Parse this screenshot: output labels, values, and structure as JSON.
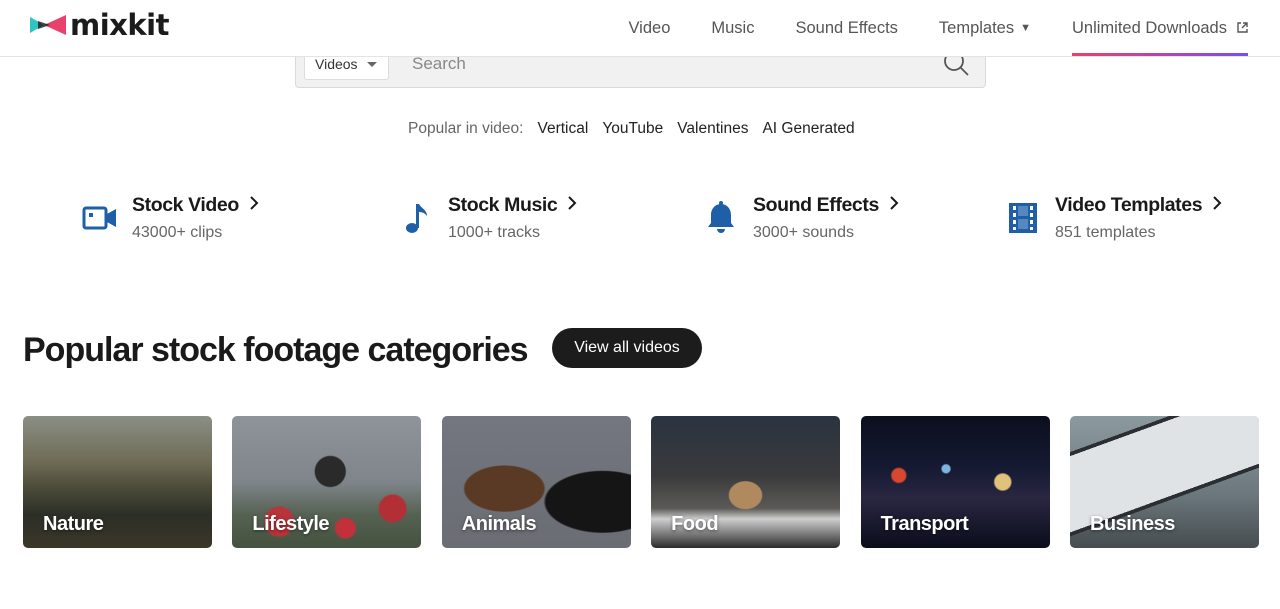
{
  "brand": {
    "name": "mixkit"
  },
  "nav": {
    "items": [
      {
        "label": "Video"
      },
      {
        "label": "Music"
      },
      {
        "label": "Sound Effects"
      },
      {
        "label": "Templates"
      },
      {
        "label": "Unlimited Downloads"
      }
    ]
  },
  "search": {
    "category": "Videos",
    "placeholder": "Search"
  },
  "popular": {
    "label": "Popular in video:",
    "links": [
      "Vertical",
      "YouTube",
      "Valentines",
      "AI Generated"
    ]
  },
  "features": [
    {
      "title": "Stock Video",
      "subtitle": "43000+ clips",
      "icon": "video-camera-icon"
    },
    {
      "title": "Stock Music",
      "subtitle": "1000+ tracks",
      "icon": "music-note-icon"
    },
    {
      "title": "Sound Effects",
      "subtitle": "3000+ sounds",
      "icon": "bell-icon"
    },
    {
      "title": "Video Templates",
      "subtitle": "851 templates",
      "icon": "film-strip-icon"
    }
  ],
  "categories": {
    "heading": "Popular stock footage categories",
    "view_all": "View all videos",
    "items": [
      {
        "label": "Nature"
      },
      {
        "label": "Lifestyle"
      },
      {
        "label": "Animals"
      },
      {
        "label": "Food"
      },
      {
        "label": "Transport"
      },
      {
        "label": "Business"
      }
    ]
  },
  "colors": {
    "accent_blue": "#1e5fa8",
    "nav_gradient_start": "#e8416b",
    "nav_gradient_end": "#7b4df0",
    "button_dark": "#1c1c1c"
  }
}
